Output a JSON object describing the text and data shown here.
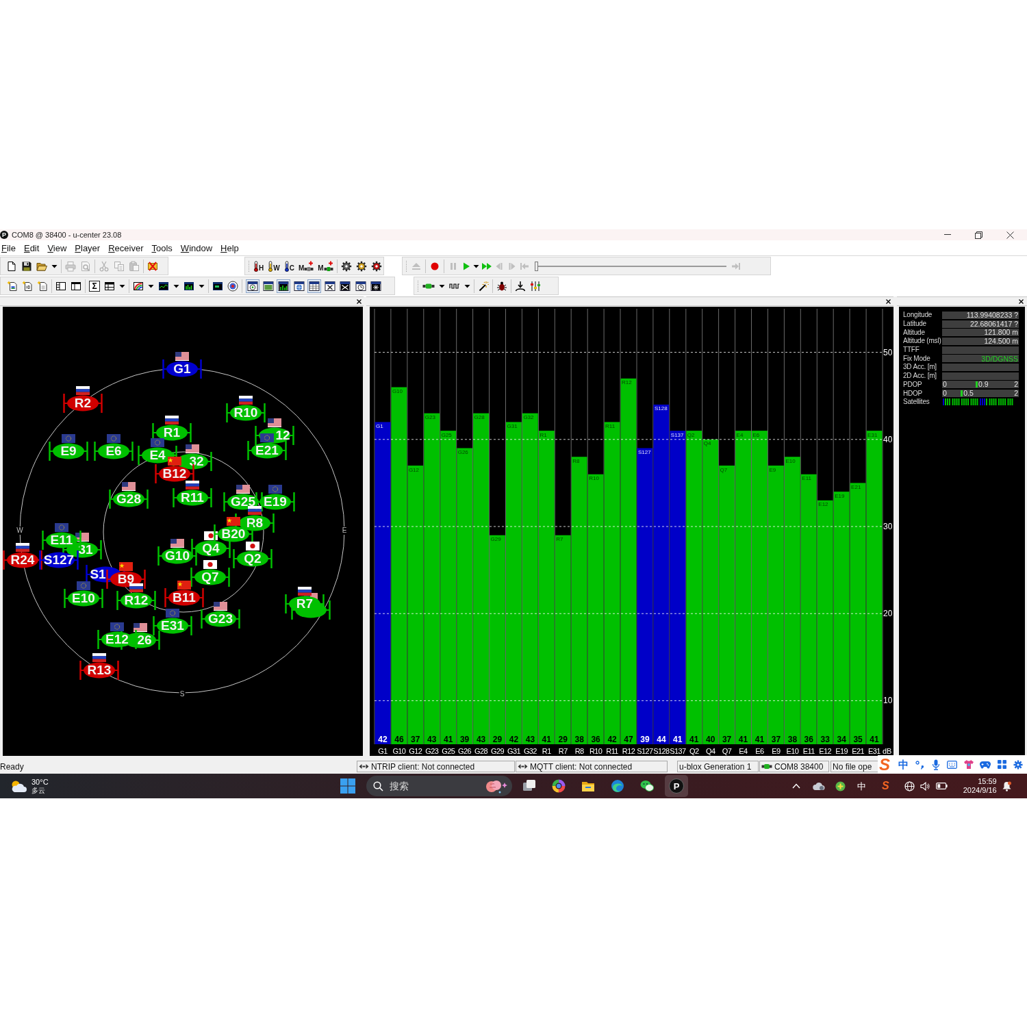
{
  "window": {
    "logo": "P",
    "title": "COM8 @ 38400 - u-center 23.08"
  },
  "menu": [
    "File",
    "Edit",
    "View",
    "Player",
    "Receiver",
    "Tools",
    "Window",
    "Help"
  ],
  "toolbar_rows": [
    [
      [
        [
          {
            "kind": "new",
            "disabled": false
          },
          {
            "kind": "save",
            "disabled": false
          },
          {
            "kind": "open",
            "disabled": false
          },
          {
            "kind": "dropdown",
            "disabled": false
          }
        ],
        [
          {
            "kind": "print",
            "disabled": true
          },
          {
            "kind": "print_preview",
            "disabled": true
          }
        ],
        [
          {
            "kind": "cut",
            "disabled": true
          },
          {
            "kind": "copy",
            "disabled": true
          },
          {
            "kind": "paste",
            "disabled": true
          }
        ],
        [
          {
            "kind": "stop_log",
            "disabled": false
          }
        ]
      ],
      [
        [
          {
            "kind": "hot",
            "text": "H",
            "disabled": false
          },
          {
            "kind": "warm",
            "text": "W",
            "disabled": false
          },
          {
            "kind": "cold",
            "text": "C",
            "disabled": false
          },
          {
            "kind": "plug",
            "text": "M",
            "disabled": false
          },
          {
            "kind": "plugon",
            "text": "M",
            "disabled": false
          }
        ],
        [
          {
            "kind": "gear",
            "disabled": false
          },
          {
            "kind": "gearb",
            "disabled": false
          },
          {
            "kind": "gearc",
            "disabled": false
          }
        ]
      ],
      [
        [
          {
            "kind": "eject",
            "disabled": true
          }
        ],
        [
          {
            "kind": "record",
            "disabled": false
          }
        ],
        [
          {
            "kind": "pause",
            "disabled": true
          },
          {
            "kind": "play",
            "disabled": false
          },
          {
            "kind": "dropdown",
            "disabled": false
          },
          {
            "kind": "fast_forward",
            "disabled": false
          },
          {
            "kind": "step_back",
            "disabled": true
          },
          {
            "kind": "step_forward",
            "disabled": true
          },
          {
            "kind": "to_start",
            "disabled": true
          },
          {
            "kind": "slider",
            "level": 0,
            "disabled": false
          },
          {
            "kind": "to_end",
            "disabled": true
          }
        ]
      ]
    ],
    [
      [
        [
          {
            "kind": "docimage",
            "disabled": false
          },
          {
            "kind": "docbinary",
            "disabled": false
          },
          {
            "kind": "docblank",
            "disabled": false
          }
        ],
        [
          {
            "kind": "layout_list",
            "disabled": false
          },
          {
            "kind": "layout_split",
            "disabled": false
          }
        ],
        [
          {
            "kind": "sigma",
            "text": "Σ",
            "disabled": false
          },
          {
            "kind": "table",
            "disabled": false
          },
          {
            "kind": "dropdown",
            "disabled": false
          }
        ],
        [
          {
            "kind": "arcchart",
            "disabled": false
          },
          {
            "kind": "dropdown",
            "disabled": false
          },
          {
            "kind": "linechart",
            "disabled": false
          },
          {
            "kind": "dropdown",
            "disabled": false
          },
          {
            "kind": "barchart",
            "disabled": false
          },
          {
            "kind": "dropdown",
            "disabled": false
          }
        ],
        [
          {
            "kind": "console",
            "disabled": false
          },
          {
            "kind": "radar",
            "disabled": false
          }
        ],
        [
          {
            "kind": "view_sky",
            "pressed": true,
            "disabled": false
          },
          {
            "kind": "view_map",
            "pressed": false,
            "disabled": false
          },
          {
            "kind": "view_bars",
            "pressed": true,
            "disabled": false
          },
          {
            "kind": "view_globe",
            "pressed": false,
            "disabled": false
          },
          {
            "kind": "view_table",
            "pressed": true,
            "disabled": false
          },
          {
            "kind": "view_fan",
            "pressed": false,
            "disabled": false
          },
          {
            "kind": "view_cross",
            "pressed": false,
            "disabled": false
          },
          {
            "kind": "view_clock",
            "pressed": false,
            "disabled": false
          },
          {
            "kind": "view_star",
            "pressed": false,
            "disabled": false
          }
        ]
      ],
      [
        [
          {
            "kind": "connector",
            "disabled": false
          },
          {
            "kind": "dropdown",
            "disabled": false
          },
          {
            "kind": "wave",
            "disabled": false
          },
          {
            "kind": "dropdown",
            "disabled": false
          }
        ],
        [
          {
            "kind": "wand",
            "disabled": false
          }
        ],
        [
          {
            "kind": "bug",
            "disabled": false
          }
        ],
        [
          {
            "kind": "download",
            "disabled": false
          },
          {
            "kind": "mixer",
            "disabled": false
          }
        ]
      ]
    ]
  ],
  "sky_view": {
    "compass": [
      "W",
      "E",
      "S"
    ],
    "satellites": [
      {
        "label": "G1",
        "color": "#0000d0",
        "kind": "gps"
      },
      {
        "label": "R2",
        "color": "#d00000",
        "kind": "glonass"
      },
      {
        "label": "R10",
        "color": "#00c000",
        "kind": "glonass"
      },
      {
        "label": "E9",
        "color": "#00c000",
        "kind": "galileo"
      },
      {
        "label": "E6",
        "color": "#00c000",
        "kind": "galileo"
      },
      {
        "label": "E4",
        "color": "#00c000",
        "kind": "galileo"
      },
      {
        "label": "R1",
        "color": "#00c000",
        "kind": "glonass"
      },
      {
        "label": "32",
        "color": "#00c000",
        "kind": "gps"
      },
      {
        "label": "E21",
        "color": "#00c000",
        "kind": "galileo"
      },
      {
        "label": "12",
        "color": "#00c000",
        "kind": "gps"
      },
      {
        "label": "B12",
        "color": "#d00000",
        "kind": "beidou"
      },
      {
        "label": "G28",
        "color": "#00c000",
        "kind": "gps"
      },
      {
        "label": "R11",
        "color": "#00c000",
        "kind": "glonass"
      },
      {
        "label": "G25",
        "color": "#00c000",
        "kind": "gps"
      },
      {
        "label": "E19",
        "color": "#00c000",
        "kind": "galileo"
      },
      {
        "label": "R8",
        "color": "#00c000",
        "kind": "glonass"
      },
      {
        "label": "E11",
        "color": "#00c000",
        "kind": "galileo"
      },
      {
        "label": "31",
        "color": "#00c000",
        "kind": "gps"
      },
      {
        "label": "Q4",
        "color": "#00c000",
        "kind": "qzss"
      },
      {
        "label": "B20",
        "color": "#00c000",
        "kind": "beidou"
      },
      {
        "label": "R24",
        "color": "#d00000",
        "kind": "glonass"
      },
      {
        "label": "S127",
        "color": "#0000d0",
        "kind": "sbas"
      },
      {
        "label": "G10",
        "color": "#00c000",
        "kind": "gps"
      },
      {
        "label": "Q2",
        "color": "#00c000",
        "kind": "qzss"
      },
      {
        "label": "S1",
        "color": "#0000d0",
        "kind": "sbas"
      },
      {
        "label": "B9",
        "color": "#d00000",
        "kind": "beidou"
      },
      {
        "label": "Q7",
        "color": "#00c000",
        "kind": "qzss"
      },
      {
        "label": "E10",
        "color": "#00c000",
        "kind": "galileo"
      },
      {
        "label": "R12",
        "color": "#00c000",
        "kind": "glonass"
      },
      {
        "label": "B11",
        "color": "#d00000",
        "kind": "beidou"
      },
      {
        "label": "R7",
        "color": "#00c000",
        "kind": "glonass"
      },
      {
        "color": "#00c000",
        "kind": "gps"
      },
      {
        "label": "E31",
        "color": "#00c000",
        "kind": "galileo"
      },
      {
        "label": "G23",
        "color": "#00c000",
        "kind": "gps"
      },
      {
        "label": "E12",
        "color": "#00c000",
        "kind": "galileo"
      },
      {
        "label": "26",
        "color": "#00c000",
        "kind": "gps"
      },
      {
        "label": "R13",
        "color": "#d00000",
        "kind": "glonass"
      }
    ]
  },
  "signal_chart": {
    "chart_data": {
      "type": "bar",
      "categories": [
        "G1",
        "G10",
        "G12",
        "G23",
        "G25",
        "G26",
        "G28",
        "G29",
        "G31",
        "G32",
        "R1",
        "R7",
        "R8",
        "R10",
        "R11",
        "R12",
        "S127",
        "S128",
        "S137",
        "Q2",
        "Q4",
        "Q7",
        "E4",
        "E6",
        "E9",
        "E10",
        "E11",
        "E12",
        "E19",
        "E21",
        "E31"
      ],
      "series": [
        {
          "color": "#0000c8",
          "values": [
            42,
            null,
            null,
            null,
            null,
            null,
            null,
            null,
            null,
            null,
            null,
            null,
            null,
            null,
            null,
            null,
            39,
            44,
            41,
            null,
            null,
            null,
            null,
            null,
            null,
            null,
            null,
            null,
            null,
            null,
            null
          ]
        },
        {
          "color": "#00c000",
          "values": [
            null,
            46,
            37,
            43,
            41,
            39,
            43,
            29,
            42,
            43,
            41,
            29,
            38,
            36,
            42,
            47,
            null,
            null,
            null,
            41,
            40,
            37,
            41,
            41,
            37,
            38,
            36,
            33,
            34,
            35,
            41
          ]
        }
      ],
      "stacked": true,
      "grid": true,
      "ylim": [
        5,
        55
      ],
      "yticks": [
        10,
        20,
        30,
        40,
        50
      ],
      "ylabel": "dB",
      "data_labels": true
    },
    "bar_tags": [
      "G1",
      "G10",
      "G12",
      "G23",
      "G25",
      "G26",
      "G28",
      "G29",
      "G31",
      "G32",
      "R1",
      "R7",
      "R8",
      "R10",
      "R11",
      "R12",
      "S127",
      "S128",
      "S137",
      "Q2",
      "Q4",
      "Q7",
      "E4",
      "E6",
      "E9",
      "E10",
      "E11",
      "E12",
      "E19",
      "E21",
      "E31"
    ]
  },
  "info_panel": {
    "rows": [
      {
        "label": "Longitude",
        "kind": "field",
        "value": "113.99408233 ?"
      },
      {
        "label": "Latitude",
        "kind": "field",
        "value": "22.68061417 ?"
      },
      {
        "label": "Altitude",
        "kind": "field",
        "value": "121.800 m"
      },
      {
        "label": "Altitude (msl)",
        "kind": "field",
        "value": "124.500 m"
      },
      {
        "label": "TTFF",
        "kind": "field"
      },
      {
        "label": "Fix Mode",
        "kind": "status",
        "value": "3D/DGNSS"
      },
      {
        "label": "3D Acc. [m]",
        "kind": "field"
      },
      {
        "label": "2D Acc. [m]",
        "kind": "field"
      },
      {
        "label": "PDOP",
        "kind": "gauge",
        "min": "0",
        "reading": "0.9",
        "max": "2",
        "level": 0.45
      },
      {
        "label": "HDOP",
        "kind": "gauge",
        "min": "0",
        "reading": "0.5",
        "max": "2",
        "level": 0.25
      },
      {
        "label": "Satellites",
        "kind": "strip"
      }
    ]
  },
  "status_bar": {
    "message": "Ready",
    "panes": [
      {
        "kind": "link",
        "text": "NTRIP client: Not connected"
      },
      {
        "kind": "link",
        "text": "MQTT client: Not connected"
      },
      {
        "kind": "plain",
        "text": "u-blox Generation 1"
      },
      {
        "kind": "port",
        "text": "COM8 38400"
      },
      {
        "kind": "plain",
        "text": "No file ope"
      }
    ]
  },
  "ime_bar": {
    "logo": "S",
    "mode": "中"
  },
  "taskbar": {
    "weather": {
      "temperature": "30°C",
      "condition": "多云"
    },
    "search": {
      "placeholder": "搜索"
    },
    "apps": [
      {
        "kind": "taskview",
        "active": false
      },
      {
        "kind": "colorring",
        "active": false
      },
      {
        "kind": "folder",
        "active": false
      },
      {
        "kind": "swirl",
        "active": false
      },
      {
        "kind": "chat",
        "active": false
      },
      {
        "kind": "letter",
        "text": "P",
        "active": true
      }
    ],
    "tray": {
      "input_mode": "中",
      "ime_logo": "S",
      "time": "15:59",
      "date": "2024/9/16"
    }
  }
}
